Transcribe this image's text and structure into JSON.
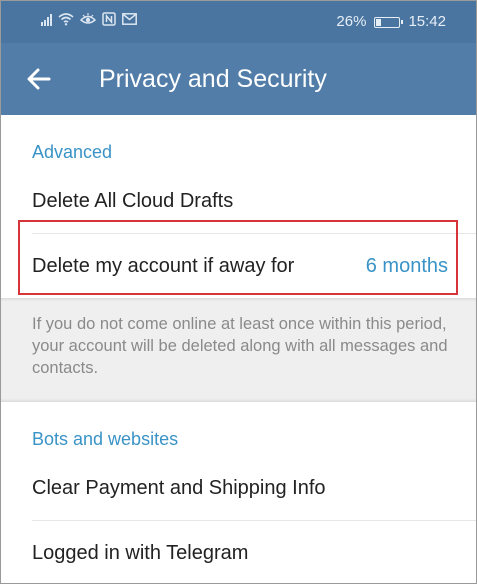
{
  "status_bar": {
    "battery_text": "26%",
    "battery_level": 0.26,
    "time": "15:42",
    "icons": [
      "signal-icon",
      "wifi-icon",
      "eye-icon",
      "nfc-icon",
      "mail-icon",
      "battery-icon"
    ]
  },
  "app_bar": {
    "back_icon": "arrow-left-icon",
    "title": "Privacy and Security"
  },
  "advanced": {
    "header": "Advanced",
    "delete_drafts_label": "Delete All Cloud Drafts",
    "delete_account_label": "Delete my account if away for",
    "delete_account_value": "6 months",
    "info_text": "If you do not come online at least once within this period, your account will be deleted along with all messages and contacts."
  },
  "bots": {
    "header": "Bots and websites",
    "clear_payment_label": "Clear Payment and Shipping Info",
    "logged_in_label": "Logged in with Telegram"
  },
  "colors": {
    "status_bar": "#4a75a1",
    "app_bar": "#517da8",
    "accent": "#3a93c6",
    "highlight": "#d6343a"
  }
}
